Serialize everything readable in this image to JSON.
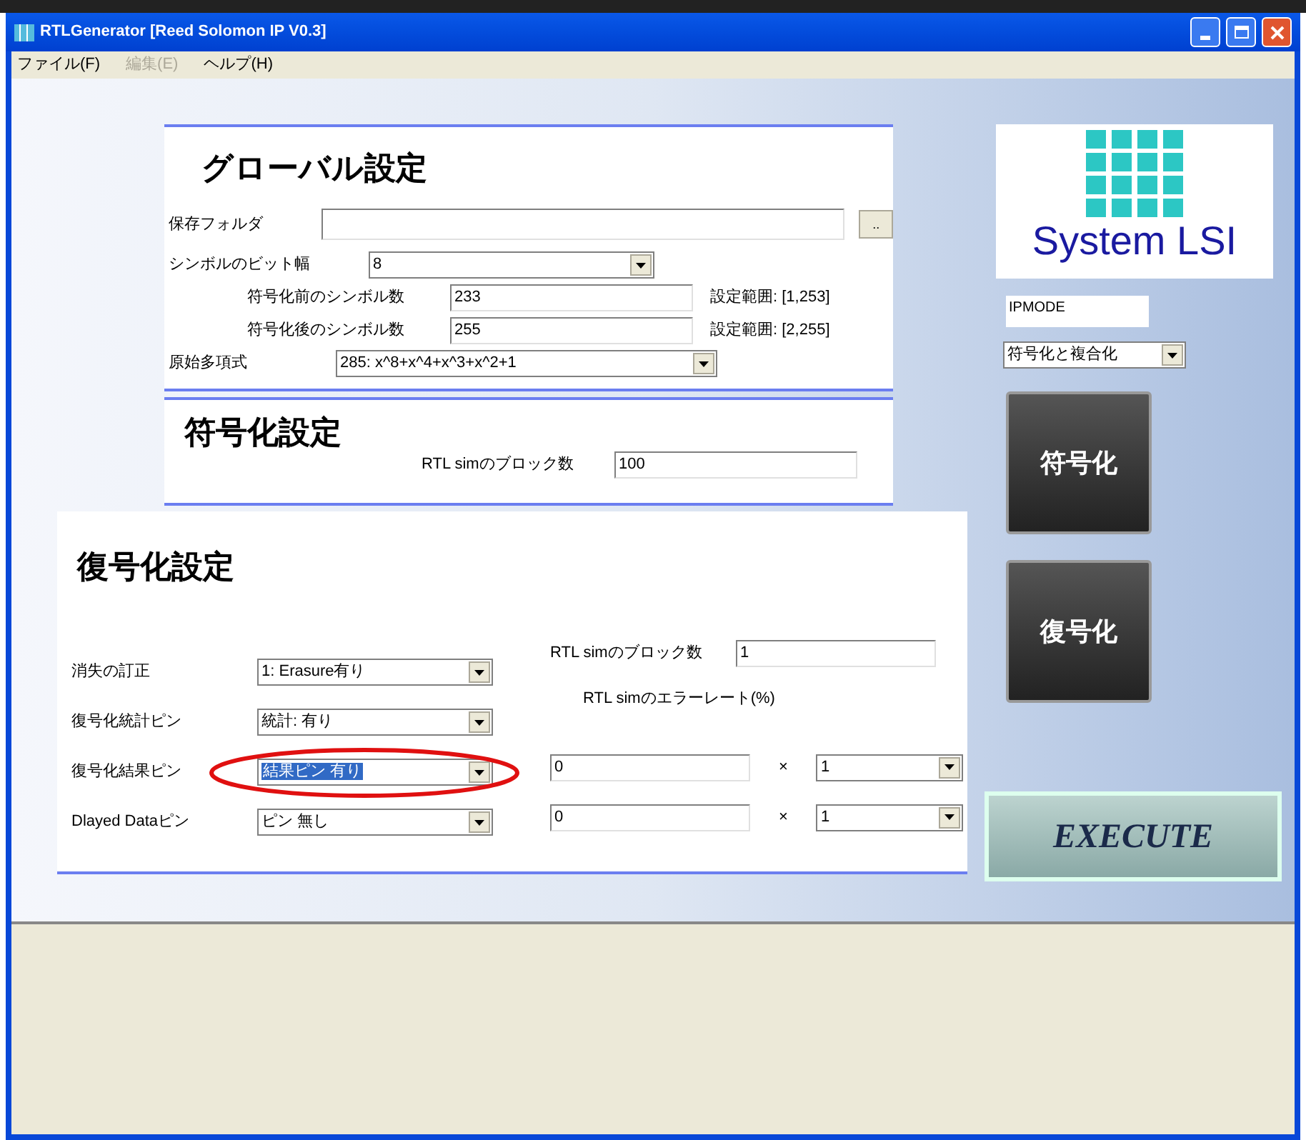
{
  "window": {
    "title": "RTLGenerator [Reed Solomon IP V0.3]"
  },
  "menu": [
    {
      "label": "ファイル(F)",
      "disabled": false
    },
    {
      "label": "編集(E)",
      "disabled": true
    },
    {
      "label": "ヘルプ(H)",
      "disabled": false
    }
  ],
  "global_settings": {
    "title": "グローバル設定",
    "save_folder": {
      "label": "保存フォルダ",
      "browse_button": ".."
    },
    "symbol_bit_width": {
      "label": "シンボルのビット幅",
      "value": "8"
    },
    "symbols_before": {
      "label": "符号化前のシンボル数",
      "value": "233",
      "range": "設定範囲: [1,253]"
    },
    "symbols_after": {
      "label": "符号化後のシンボル数",
      "value": "255",
      "range": "設定範囲: [2,255]"
    },
    "polynomial": {
      "label": "原始多項式",
      "value": "285: x^8+x^4+x^3+x^2+1"
    }
  },
  "encoding_settings": {
    "title": "符号化設定",
    "block_count": {
      "label": "RTL simのブロック数",
      "value": "100"
    }
  },
  "decoding_settings": {
    "title": "復号化設定",
    "block_count": {
      "label": "RTL simのブロック数",
      "value": "1"
    },
    "error_rate_label": "RTL simのエラーレート(%)",
    "rows": [
      {
        "label": "消失の訂正",
        "value": "1: Erasure有り",
        "highlighted": false,
        "circled": false
      },
      {
        "label": "復号化統計ピン",
        "value": "統計: 有り",
        "highlighted": false,
        "circled": false
      },
      {
        "label": "復号化結果ピン",
        "value": "結果ピン 有り",
        "highlighted": true,
        "circled": true,
        "rate": "0",
        "times": "×",
        "multiplier": "1"
      },
      {
        "label": "Dlayed Dataピン",
        "value": "ピン 無し",
        "highlighted": false,
        "circled": false,
        "rate": "0",
        "times": "×",
        "multiplier": "1"
      }
    ]
  },
  "side_panel": {
    "logo": {
      "text": "System LSI"
    },
    "ip_mode": "IPMODE",
    "mode_select": {
      "value": "符号化と複合化"
    },
    "buttons": [
      {
        "label": "符号化"
      },
      {
        "label": "復号化"
      }
    ],
    "execute": {
      "label": "EXECUTE"
    }
  }
}
